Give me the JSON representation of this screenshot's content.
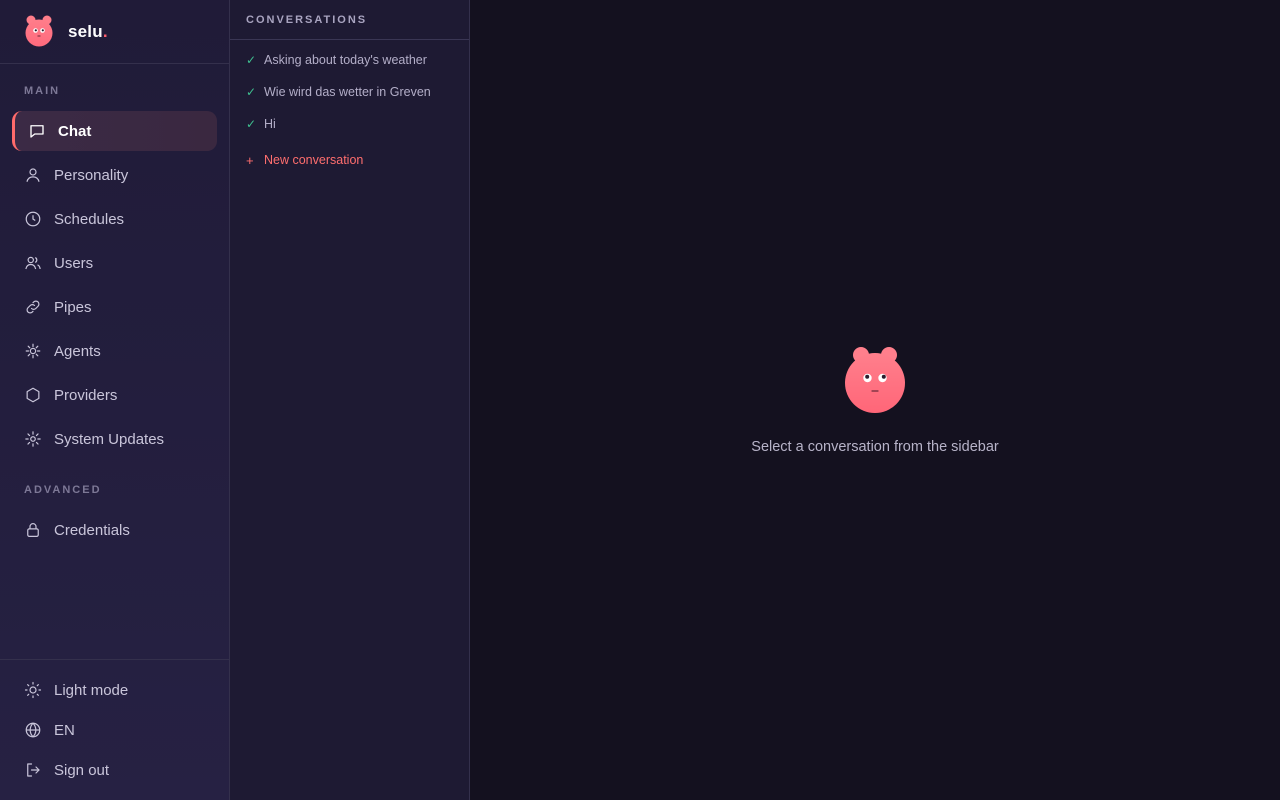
{
  "app": {
    "name": "selu",
    "name_dot": ".",
    "accent": "#ff5f6d"
  },
  "sidebar": {
    "sections": {
      "main": "MAIN",
      "advanced": "ADVANCED"
    },
    "items": [
      {
        "label": "Chat",
        "icon": "chat-icon",
        "active": true
      },
      {
        "label": "Personality",
        "icon": "person-icon"
      },
      {
        "label": "Schedules",
        "icon": "clock-icon"
      },
      {
        "label": "Users",
        "icon": "users-icon"
      },
      {
        "label": "Pipes",
        "icon": "link-icon"
      },
      {
        "label": "Agents",
        "icon": "spark-icon"
      },
      {
        "label": "Providers",
        "icon": "hexagon-icon"
      },
      {
        "label": "System Updates",
        "icon": "gear-icon"
      },
      {
        "label": "Credentials",
        "icon": "lock-icon"
      }
    ],
    "bottom": [
      {
        "label": "Light mode",
        "icon": "sun-icon"
      },
      {
        "label": "EN",
        "icon": "globe-icon"
      },
      {
        "label": "Sign out",
        "icon": "sign-out-icon"
      }
    ]
  },
  "conversations": {
    "header": "CONVERSATIONS",
    "items": [
      {
        "title": "Asking about today's weather",
        "status": "done"
      },
      {
        "title": "Wie wird das wetter in Greven",
        "status": "done"
      },
      {
        "title": "Hi",
        "status": "done"
      }
    ],
    "new_label": "New conversation",
    "check_glyph": "✓",
    "plus_glyph": "+"
  },
  "main": {
    "empty_text": "Select a conversation from the sidebar"
  }
}
